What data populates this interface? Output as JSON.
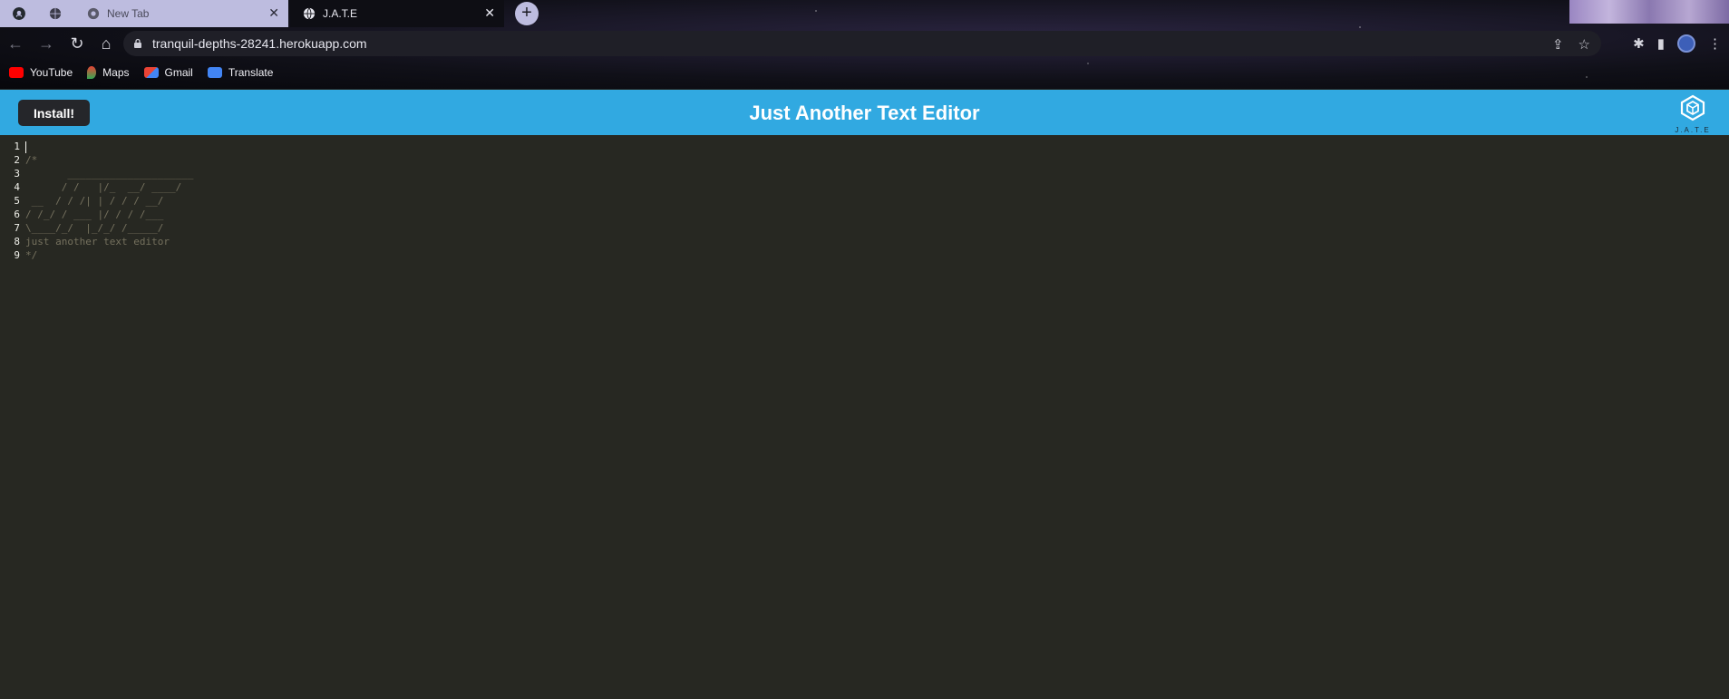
{
  "browser": {
    "tabs": [
      {
        "title": "",
        "icon": "github-icon",
        "active": false
      },
      {
        "title": "",
        "icon": "globe-icon",
        "active": false
      },
      {
        "title": "New Tab",
        "icon": "chrome-icon",
        "active": false
      },
      {
        "title": "J.A.T.E",
        "icon": "globe-icon",
        "active": true
      }
    ],
    "url": "tranquil-depths-28241.herokuapp.com",
    "bookmarks": [
      {
        "label": "YouTube",
        "icon": "youtube-icon",
        "color": "#ff0000"
      },
      {
        "label": "Maps",
        "icon": "maps-icon",
        "color": "#34a853"
      },
      {
        "label": "Gmail",
        "icon": "gmail-icon",
        "color": "#ea4335"
      },
      {
        "label": "Translate",
        "icon": "translate-icon",
        "color": "#4285f4"
      }
    ]
  },
  "app": {
    "install_label": "Install!",
    "title": "Just Another Text Editor",
    "logo_text": "J.A.T.E",
    "accent": "#31a9e1"
  },
  "editor": {
    "lines": [
      {
        "num": "1",
        "text": ""
      },
      {
        "num": "2",
        "text": "/*"
      },
      {
        "num": "3",
        "text": "       _____________________"
      },
      {
        "num": "4",
        "text": "      / /   |/_  __/ ____/"
      },
      {
        "num": "5",
        "text": " __  / / /| | / / / __/"
      },
      {
        "num": "6",
        "text": "/ /_/ / ___ |/ / / /___"
      },
      {
        "num": "7",
        "text": "\\____/_/  |_/_/ /_____/"
      },
      {
        "num": "8",
        "text": "just another text editor"
      },
      {
        "num": "9",
        "text": "*/"
      }
    ],
    "background": "#272822"
  }
}
